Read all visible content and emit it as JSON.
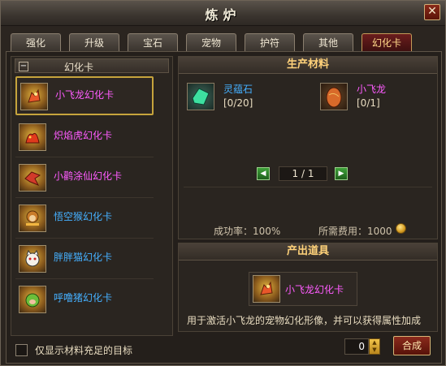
{
  "window": {
    "title": "炼炉",
    "close_glyph": "✕"
  },
  "tabs": [
    {
      "label": "强化"
    },
    {
      "label": "升级"
    },
    {
      "label": "宝石"
    },
    {
      "label": "宠物"
    },
    {
      "label": "护符"
    },
    {
      "label": "其他"
    },
    {
      "label": "幻化卡",
      "active": true
    }
  ],
  "sidebar": {
    "category": {
      "toggle": "−",
      "title": "幻化卡"
    },
    "items": [
      {
        "name": "小飞龙幻化卡",
        "color": "#ff5cff",
        "icon": "small-dragon-icon",
        "selected": true
      },
      {
        "name": "炽焰虎幻化卡",
        "color": "#ff5cff",
        "icon": "flame-tiger-icon"
      },
      {
        "name": "小鹳涂仙幻化卡",
        "color": "#ff5cff",
        "icon": "crane-immortal-icon"
      },
      {
        "name": "悟空猴幻化卡",
        "color": "#45b0ff",
        "icon": "monkey-king-icon"
      },
      {
        "name": "胖胖猫幻化卡",
        "color": "#45b0ff",
        "icon": "chubby-cat-icon"
      },
      {
        "name": "呼噜猪幻化卡",
        "color": "#45b0ff",
        "icon": "snoring-pig-icon"
      }
    ],
    "filter_label": "仅显示材料充足的目标"
  },
  "materials": {
    "header": "生产材料",
    "items": [
      {
        "name": "灵蕴石",
        "count": "[0/20]",
        "icon": "spirit-stone-icon"
      },
      {
        "name": "小飞龙",
        "count": "[0/1]",
        "icon": "dragon-egg-icon"
      }
    ],
    "page": "1 / 1",
    "success_rate": "成功率：100%",
    "cost": "所需费用：1000"
  },
  "output": {
    "header": "产出道具",
    "item_name": "小飞龙幻化卡",
    "description": "用于激活小飞龙的宠物幻化形像，并可以获得属性加成"
  },
  "footer": {
    "quantity": "0",
    "craft_label": "合成"
  },
  "colors": {
    "accent_gold": "#c6a43c",
    "header_text": "#ffd27a",
    "pink_name": "#ff5cff",
    "blue_name": "#45b0ff"
  }
}
